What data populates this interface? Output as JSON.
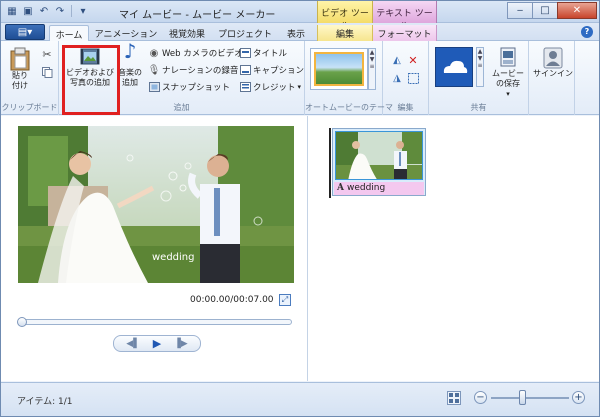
{
  "window": {
    "title": "マイ ムービー - ムービー メーカー",
    "context_video_tools": "ビデオ ツール",
    "context_text_tools": "テキスト ツール"
  },
  "tabs": [
    {
      "label": "ホーム",
      "active": true
    },
    {
      "label": "アニメーション"
    },
    {
      "label": "視覚効果"
    },
    {
      "label": "プロジェクト"
    },
    {
      "label": "表示"
    },
    {
      "label": "編集"
    },
    {
      "label": "フォーマット"
    }
  ],
  "ribbon": {
    "clipboard": {
      "paste_label": "貼り付け",
      "group_label": "クリップボード"
    },
    "add": {
      "add_video_photo_label": "ビデオおよび写真の追加",
      "add_music_label": "音楽の追加",
      "webcam_label": "Web カメラのビデオ",
      "narration_label": "ナレーションの録音",
      "snapshot_label": "スナップショット",
      "title_label": "タイトル",
      "caption_label": "キャプション",
      "credits_label": "クレジット",
      "group_label": "追加"
    },
    "automovie": {
      "group_label": "オートムービーのテーマ"
    },
    "edit": {
      "group_label": "編集"
    },
    "share": {
      "save_movie_label": "ムービーの保存",
      "group_label": "共有"
    },
    "signin": {
      "label": "サインイン"
    }
  },
  "preview": {
    "caption_text": "wedding",
    "time": "00:00.00/00:07.00",
    "seek_fraction": 0
  },
  "storyboard": {
    "clips": [
      {
        "label": "wedding"
      }
    ]
  },
  "status": {
    "items_text": "アイテム: 1/1",
    "zoom_fraction": 0.4
  },
  "colors": {
    "accent": "#2e6bc3",
    "highlight_box": "#e02020",
    "text_overlay_label": "#f4c8ef"
  }
}
